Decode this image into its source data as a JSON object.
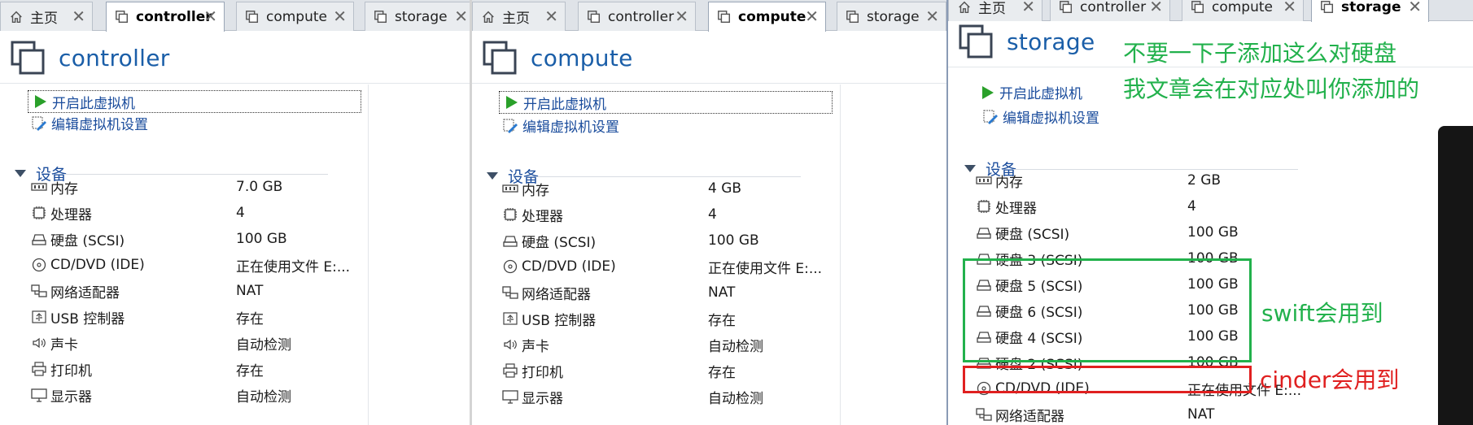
{
  "colors": {
    "title_blue": "#1a5ea8",
    "link_blue": "#1a4c9c",
    "annotation_green": "#22b14c",
    "annotation_red": "#e02020"
  },
  "tabs": [
    {
      "label": "主页",
      "icon": "home-icon"
    },
    {
      "label": "controller",
      "icon": "vm-tab-icon"
    },
    {
      "label": "compute",
      "icon": "vm-tab-icon"
    },
    {
      "label": "storage",
      "icon": "vm-tab-icon"
    }
  ],
  "actions": {
    "power_on": "开启此虚拟机",
    "edit_settings": "编辑虚拟机设置"
  },
  "section_devices": "设备",
  "panels": {
    "controller": {
      "title": "controller",
      "active_tab": "controller",
      "devices": [
        {
          "name": "内存",
          "value": "7.0 GB",
          "icon": "memory-icon"
        },
        {
          "name": "处理器",
          "value": "4",
          "icon": "cpu-icon"
        },
        {
          "name": "硬盘 (SCSI)",
          "value": "100 GB",
          "icon": "disk-icon"
        },
        {
          "name": "CD/DVD (IDE)",
          "value": "正在使用文件 E:...",
          "icon": "cd-icon"
        },
        {
          "name": "网络适配器",
          "value": "NAT",
          "icon": "network-icon"
        },
        {
          "name": "USB 控制器",
          "value": "存在",
          "icon": "usb-icon"
        },
        {
          "name": "声卡",
          "value": "自动检测",
          "icon": "sound-icon"
        },
        {
          "name": "打印机",
          "value": "存在",
          "icon": "printer-icon"
        },
        {
          "name": "显示器",
          "value": "自动检测",
          "icon": "monitor-icon"
        }
      ]
    },
    "compute": {
      "title": "compute",
      "active_tab": "compute",
      "devices": [
        {
          "name": "内存",
          "value": "4 GB",
          "icon": "memory-icon"
        },
        {
          "name": "处理器",
          "value": "4",
          "icon": "cpu-icon"
        },
        {
          "name": "硬盘 (SCSI)",
          "value": "100 GB",
          "icon": "disk-icon"
        },
        {
          "name": "CD/DVD (IDE)",
          "value": "正在使用文件 E:...",
          "icon": "cd-icon"
        },
        {
          "name": "网络适配器",
          "value": "NAT",
          "icon": "network-icon"
        },
        {
          "name": "USB 控制器",
          "value": "存在",
          "icon": "usb-icon"
        },
        {
          "name": "声卡",
          "value": "自动检测",
          "icon": "sound-icon"
        },
        {
          "name": "打印机",
          "value": "存在",
          "icon": "printer-icon"
        },
        {
          "name": "显示器",
          "value": "自动检测",
          "icon": "monitor-icon"
        }
      ]
    },
    "storage": {
      "title": "storage",
      "active_tab": "storage",
      "devices": [
        {
          "name": "内存",
          "value": "2 GB",
          "icon": "memory-icon"
        },
        {
          "name": "处理器",
          "value": "4",
          "icon": "cpu-icon"
        },
        {
          "name": "硬盘 (SCSI)",
          "value": "100 GB",
          "icon": "disk-icon"
        },
        {
          "name": "硬盘 3 (SCSI)",
          "value": "100 GB",
          "icon": "disk-icon"
        },
        {
          "name": "硬盘 5 (SCSI)",
          "value": "100 GB",
          "icon": "disk-icon"
        },
        {
          "name": "硬盘 6 (SCSI)",
          "value": "100 GB",
          "icon": "disk-icon"
        },
        {
          "name": "硬盘 4 (SCSI)",
          "value": "100 GB",
          "icon": "disk-icon"
        },
        {
          "name": "硬盘 2 (SCSI)",
          "value": "100 GB",
          "icon": "disk-icon"
        },
        {
          "name": "CD/DVD (IDE)",
          "value": "正在使用文件 E:...",
          "icon": "cd-icon"
        },
        {
          "name": "网络适配器",
          "value": "NAT",
          "icon": "network-icon"
        }
      ]
    }
  },
  "annotations": {
    "note_line1": "不要一下子添加这么对硬盘",
    "note_line2": "我文章会在对应处叫你添加的",
    "swift_label": "swift会用到",
    "cinder_label": "cinder会用到"
  }
}
